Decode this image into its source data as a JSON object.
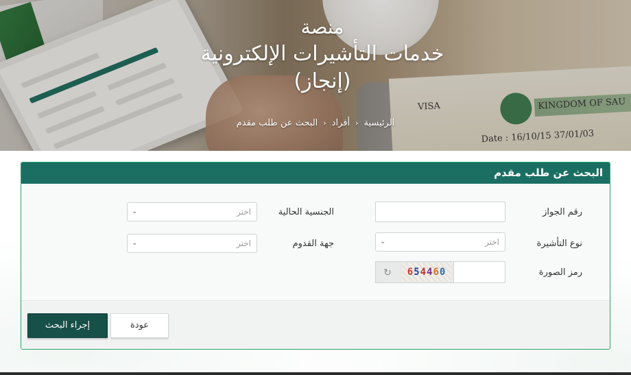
{
  "hero": {
    "title_line1": "منصة",
    "title_line2": "خدمات التأشيرات الإلكترونية",
    "title_line3": "(إنجاز)",
    "visa_words": {
      "visa": "VISA",
      "kingdom": "KINGDOM OF SAU",
      "date": "Date :  16/10/15  37/01/03"
    }
  },
  "breadcrumb": {
    "items": [
      "الرئيسية",
      "أفراد",
      "البحث عن طلب مقدم"
    ],
    "separator": "‹"
  },
  "form": {
    "title": "البحث عن طلب مقدم",
    "passport_label": "رقم الجواز",
    "passport_value": "",
    "nationality_label": "الجنسية الحالية",
    "nationality_value": "اختر",
    "visa_type_label": "نوع التأشيرة",
    "visa_type_value": "اختر",
    "arrival_label": "جهة القدوم",
    "arrival_value": "اختر",
    "captcha_label": "رمز الصورة",
    "captcha_value": "",
    "captcha_digits": [
      "6",
      "5",
      "4",
      "4",
      "6",
      "0"
    ]
  },
  "actions": {
    "search_label": "إجراء البحث",
    "back_label": "عودة"
  },
  "colors": {
    "header_teal": "#1a6f62",
    "card_border": "#2ea36a",
    "primary_button": "#174f49"
  },
  "icons": {
    "chevron": "chevron-down-icon",
    "refresh": "refresh-icon"
  }
}
